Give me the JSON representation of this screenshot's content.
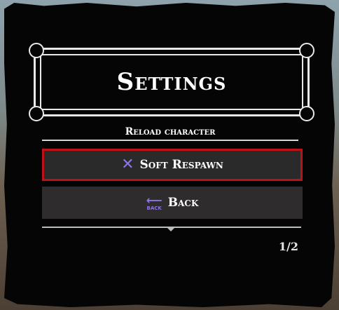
{
  "menu": {
    "title": "Settings",
    "subtitle": "Reload character",
    "items": [
      {
        "label": "Soft Respawn",
        "icon": "x-button-icon",
        "selected": true
      },
      {
        "label": "Back",
        "icon": "back-arrow-icon",
        "icon_caption": "BACK",
        "selected": false
      }
    ],
    "page_indicator": "1/2"
  },
  "colors": {
    "accent_selected_border": "#c01018",
    "icon_purple": "#8f74e6",
    "panel_bg": "#050505",
    "button_bg": "#2c2a2b",
    "text": "#ffffff"
  }
}
